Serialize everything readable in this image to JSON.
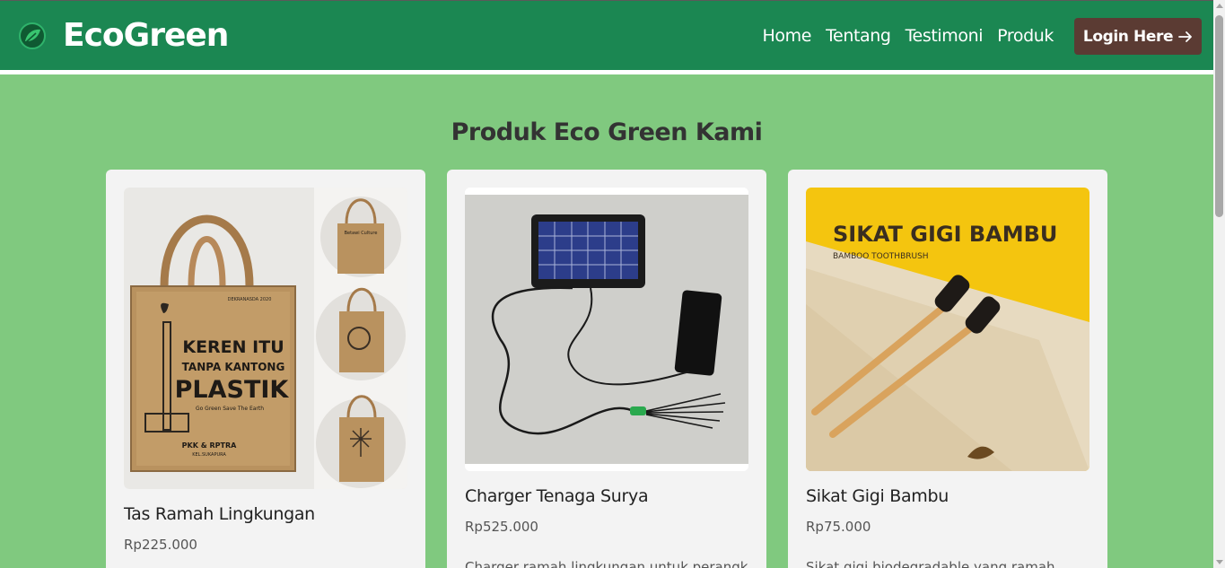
{
  "brand": {
    "name": "EcoGreen",
    "icon": "leaf-icon"
  },
  "nav": {
    "links": [
      "Home",
      "Tentang",
      "Testimoni",
      "Produk"
    ],
    "login_label": "Login Here",
    "login_icon": "arrow-right-icon"
  },
  "section": {
    "title": "Produk Eco Green Kami"
  },
  "products": [
    {
      "name": "Tas Ramah Lingkungan",
      "price": "Rp225.000",
      "desc": "",
      "image": {
        "line1": "KEREN ITU",
        "line2": "TANPA KANTONG",
        "line3": "PLASTIK",
        "small_top": "DEKRANASDA 2020",
        "tag": "Go Green Save The Earth",
        "bottom1": "PKK & RPTRA",
        "bottom2": "KEL.SUKAPURA",
        "side_title": "Betawi Culture"
      }
    },
    {
      "name": "Charger Tenaga Surya",
      "price": "Rp525.000",
      "desc": "Charger ramah lingkungan untuk perangkat"
    },
    {
      "name": "Sikat Gigi Bambu",
      "price": "Rp75.000",
      "desc": "Sikat gigi biodegradable yang ramah",
      "image": {
        "title": "SIKAT GIGI BAMBU",
        "subtitle": "BAMBOO TOOTHBRUSH"
      }
    }
  ],
  "colors": {
    "navbar": "#1b8752",
    "page_bg": "#80c97f",
    "login_bg": "#5b3b33",
    "card_bg": "#f3f3f3"
  }
}
